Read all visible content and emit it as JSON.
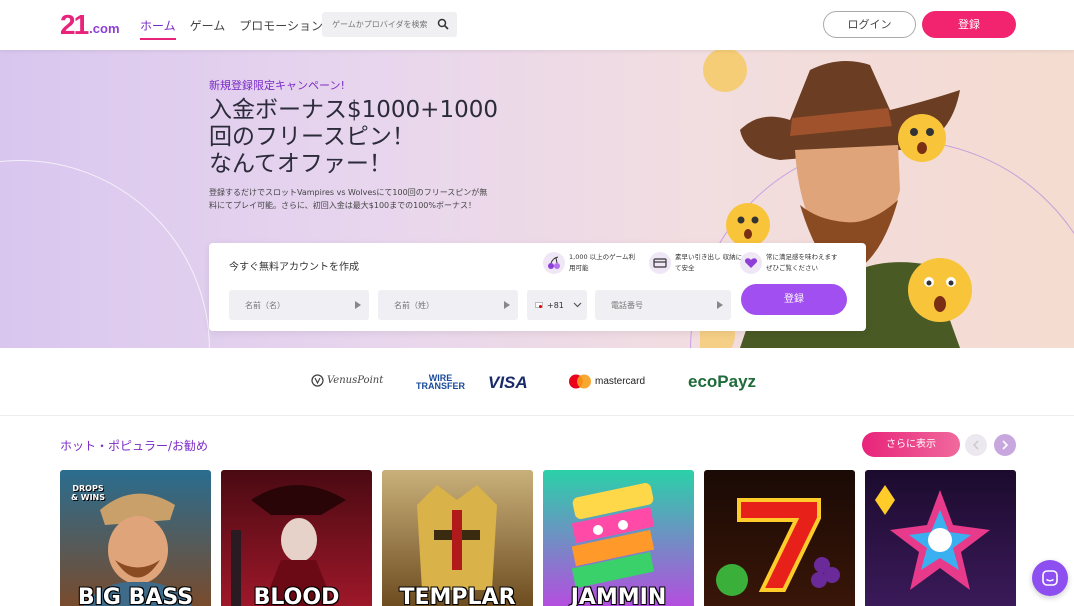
{
  "header": {
    "logo_big": "21",
    "logo_domain": ".com",
    "nav": [
      "ホーム",
      "ゲーム",
      "プロモーション"
    ],
    "search_placeholder": "ゲームかプロバイダを検索",
    "login_label": "ログイン",
    "register_label": "登録"
  },
  "hero": {
    "promo_tag": "新規登録限定キャンペーン!",
    "headline": [
      "入金ボーナス$1000+1000",
      "回のフリースピン！",
      "なんてオファー！"
    ],
    "description": "登録するだけでスロットVampires vs Wolvesにて100回のフリースピンが無料にてプレイ可能。さらに、初回入金は最大$100までの100%ボーナス！"
  },
  "signup": {
    "title": "今すぐ無料アカウントを作成",
    "perks": [
      {
        "icon": "cherry-icon",
        "text": "1,000 以上のゲーム利用可能"
      },
      {
        "icon": "card-icon",
        "text": "素早い引き出し 収納にて安全"
      },
      {
        "icon": "heart-icon",
        "text": "常に満足感を味わえます ぜひご覧ください"
      }
    ],
    "first_name_placeholder": "名前（名）",
    "last_name_placeholder": "名前（姓）",
    "country_code": "+81",
    "phone_placeholder": "電話番号",
    "submit_label": "登録"
  },
  "payments": [
    "VenusPoint",
    "WIRE TRANSFER",
    "VISA",
    "mastercard",
    "ecoPayz"
  ],
  "games": {
    "section_title": "ホット・ポピュラー/お勧め",
    "more_label": "さらに表示",
    "tiles": [
      {
        "name": "BIG BASS",
        "badge": "DROPS & WINS",
        "colors": [
          "#2a6d8f",
          "#7b4a2a"
        ]
      },
      {
        "name": "BLOOD",
        "colors": [
          "#4a0a12",
          "#a0182a"
        ]
      },
      {
        "name": "TEMPLAR",
        "colors": [
          "#c9b07a",
          "#6b4a1e"
        ]
      },
      {
        "name": "JAMMIN",
        "colors": [
          "#2ad1a8",
          "#b84ae0"
        ]
      },
      {
        "name": "",
        "colors": [
          "#1a0a05",
          "#3a1608"
        ]
      },
      {
        "name": "",
        "colors": [
          "#1c0b2e",
          "#3b1a5a"
        ]
      }
    ]
  }
}
